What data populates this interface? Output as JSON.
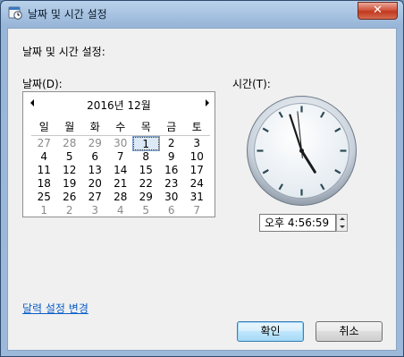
{
  "window": {
    "title": "날짜 및 시간 설정",
    "close_glyph": "✕"
  },
  "main": {
    "heading": "날짜 및 시간 설정:",
    "date_label": "날짜(D):",
    "time_label": "시간(T):"
  },
  "calendar": {
    "month_title": "2016년 12월",
    "weekdays": [
      "일",
      "월",
      "화",
      "수",
      "목",
      "금",
      "토"
    ],
    "weeks": [
      [
        "27",
        "28",
        "29",
        "30",
        "1",
        "2",
        "3"
      ],
      [
        "4",
        "5",
        "6",
        "7",
        "8",
        "9",
        "10"
      ],
      [
        "11",
        "12",
        "13",
        "14",
        "15",
        "16",
        "17"
      ],
      [
        "18",
        "19",
        "20",
        "21",
        "22",
        "23",
        "24"
      ],
      [
        "25",
        "26",
        "27",
        "28",
        "29",
        "30",
        "31"
      ],
      [
        "1",
        "2",
        "3",
        "4",
        "5",
        "6",
        "7"
      ]
    ],
    "selected_day": "1"
  },
  "clock": {
    "hour": 4,
    "minute": 56,
    "second": 59
  },
  "time_field": {
    "value": "오후   4:56:59"
  },
  "link": {
    "label": "달력 설정 변경"
  },
  "buttons": {
    "ok": "확인",
    "cancel": "취소"
  },
  "colors": {
    "accent": "#0b5ec9",
    "close": "#c0391f"
  }
}
